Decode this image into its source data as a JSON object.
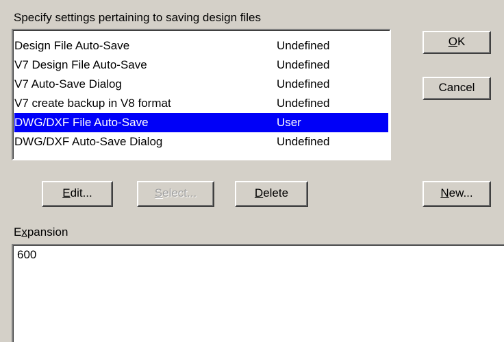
{
  "header": {
    "caption": "Specify settings pertaining to saving design files"
  },
  "settings": {
    "rows": [
      {
        "name": "Design File Auto-Save",
        "value": "Undefined"
      },
      {
        "name": "V7 Design File Auto-Save",
        "value": "Undefined"
      },
      {
        "name": "V7 Auto-Save Dialog",
        "value": "Undefined"
      },
      {
        "name": "V7 create backup in V8 format",
        "value": "Undefined"
      },
      {
        "name": "DWG/DXF File Auto-Save",
        "value": "User",
        "selected": true
      },
      {
        "name": "DWG/DXF Auto-Save Dialog",
        "value": "Undefined"
      }
    ]
  },
  "buttons": {
    "ok": {
      "mnemonic": "O",
      "rest": "K"
    },
    "cancel": {
      "label": "Cancel"
    },
    "edit": {
      "mnemonic": "E",
      "rest": "dit..."
    },
    "select": {
      "mnemonic": "S",
      "rest": "elect...",
      "disabled": true
    },
    "delete": {
      "mnemonic": "D",
      "rest": "elete"
    },
    "new": {
      "mnemonic": "N",
      "rest": "ew..."
    }
  },
  "expansion": {
    "label_pre": "E",
    "label_mnemonic": "x",
    "label_post": "pansion",
    "value": "600"
  },
  "colors": {
    "selection": "#0000f8",
    "face": "#d4d0c8"
  }
}
